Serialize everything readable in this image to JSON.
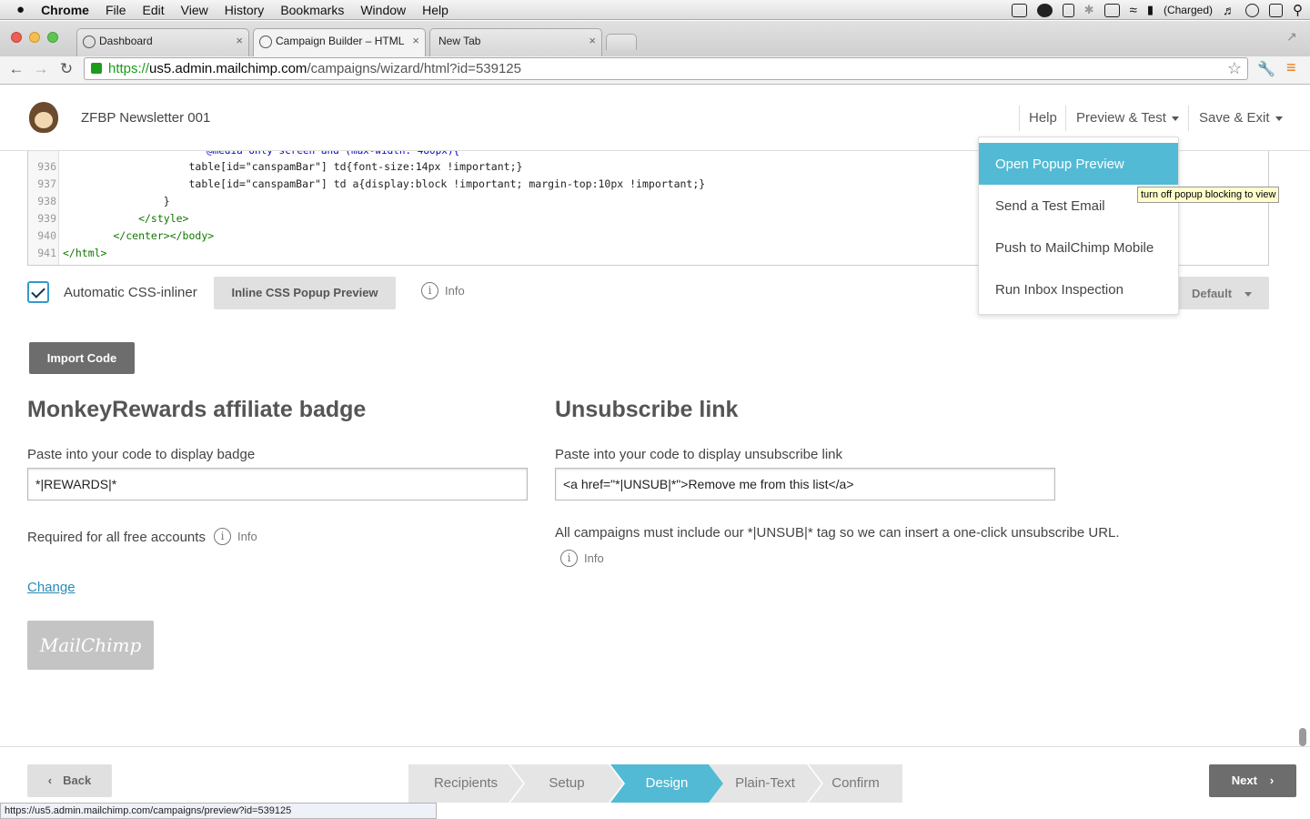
{
  "menubar": {
    "apple": "",
    "items": [
      "Chrome",
      "File",
      "Edit",
      "View",
      "History",
      "Bookmarks",
      "Window",
      "Help"
    ],
    "battery": "(Charged)"
  },
  "tabs": [
    {
      "title": "Dashboard"
    },
    {
      "title": "Campaign Builder – HTML"
    },
    {
      "title": "New Tab"
    }
  ],
  "address": {
    "protocol": "https://",
    "host": "us5.admin.mailchimp.com",
    "path": "/campaigns/wizard/html?id=539125"
  },
  "header": {
    "campaign_name": "ZFBP Newsletter 001",
    "help": "Help",
    "preview_test": "Preview & Test",
    "save_exit": "Save & Exit"
  },
  "code": {
    "lines": [
      {
        "num": "936",
        "pre": "                    table[id=\"canspamBar\"] td{font-size:14px !important;}"
      },
      {
        "num": "937",
        "pre": "                    table[id=\"canspamBar\"] td a{display:block !important; margin-top:10px !important;}"
      },
      {
        "num": "938",
        "pre": "                }"
      },
      {
        "num": "939",
        "pre": "            </style>"
      },
      {
        "num": "940",
        "pre": "        </center></body>"
      },
      {
        "num": "941",
        "pre": "</html>"
      }
    ]
  },
  "options": {
    "inliner_label": "Automatic CSS-inliner",
    "inliner_checked": true,
    "inline_preview_btn": "Inline CSS Popup Preview",
    "info": "Info",
    "default_btn": "Default"
  },
  "import_btn": "Import Code",
  "badge": {
    "heading": "MonkeyRewards affiliate badge",
    "label": "Paste into your code to display badge",
    "value": "*|REWARDS|*",
    "note": "Required for all free accounts",
    "info": "Info",
    "change": "Change",
    "logo_text": "MailChimp"
  },
  "unsub": {
    "heading": "Unsubscribe link",
    "label": "Paste into your code to display unsubscribe link",
    "value": "<a href=\"*|UNSUB|*\">Remove me from this list</a>",
    "note": "All campaigns must include our *|UNSUB|* tag so we can insert a one-click unsubscribe URL.",
    "info": "Info"
  },
  "dropdown": {
    "items": [
      "Open Popup Preview",
      "Send a Test Email",
      "Push to MailChimp Mobile",
      "Run Inbox Inspection"
    ],
    "tooltip": "turn off popup blocking to view"
  },
  "footer": {
    "back": "Back",
    "next": "Next",
    "steps": [
      "Recipients",
      "Setup",
      "Design",
      "Plain-Text",
      "Confirm"
    ],
    "current_step": "Design"
  },
  "statusbar": "https://us5.admin.mailchimp.com/campaigns/preview?id=539125"
}
